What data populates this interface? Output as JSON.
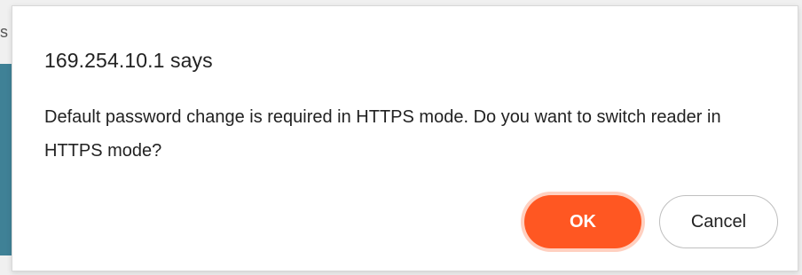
{
  "dialog": {
    "title": "169.254.10.1 says",
    "message": "Default password change is required in HTTPS mode. Do you want to switch reader in HTTPS mode?",
    "buttons": {
      "ok_label": "OK",
      "cancel_label": "Cancel"
    }
  },
  "background": {
    "edge_glyph": "s"
  },
  "colors": {
    "ok_button": "#ff5722",
    "ok_focus_ring": "#ffd0c0",
    "background_strip": "#3f8196"
  }
}
